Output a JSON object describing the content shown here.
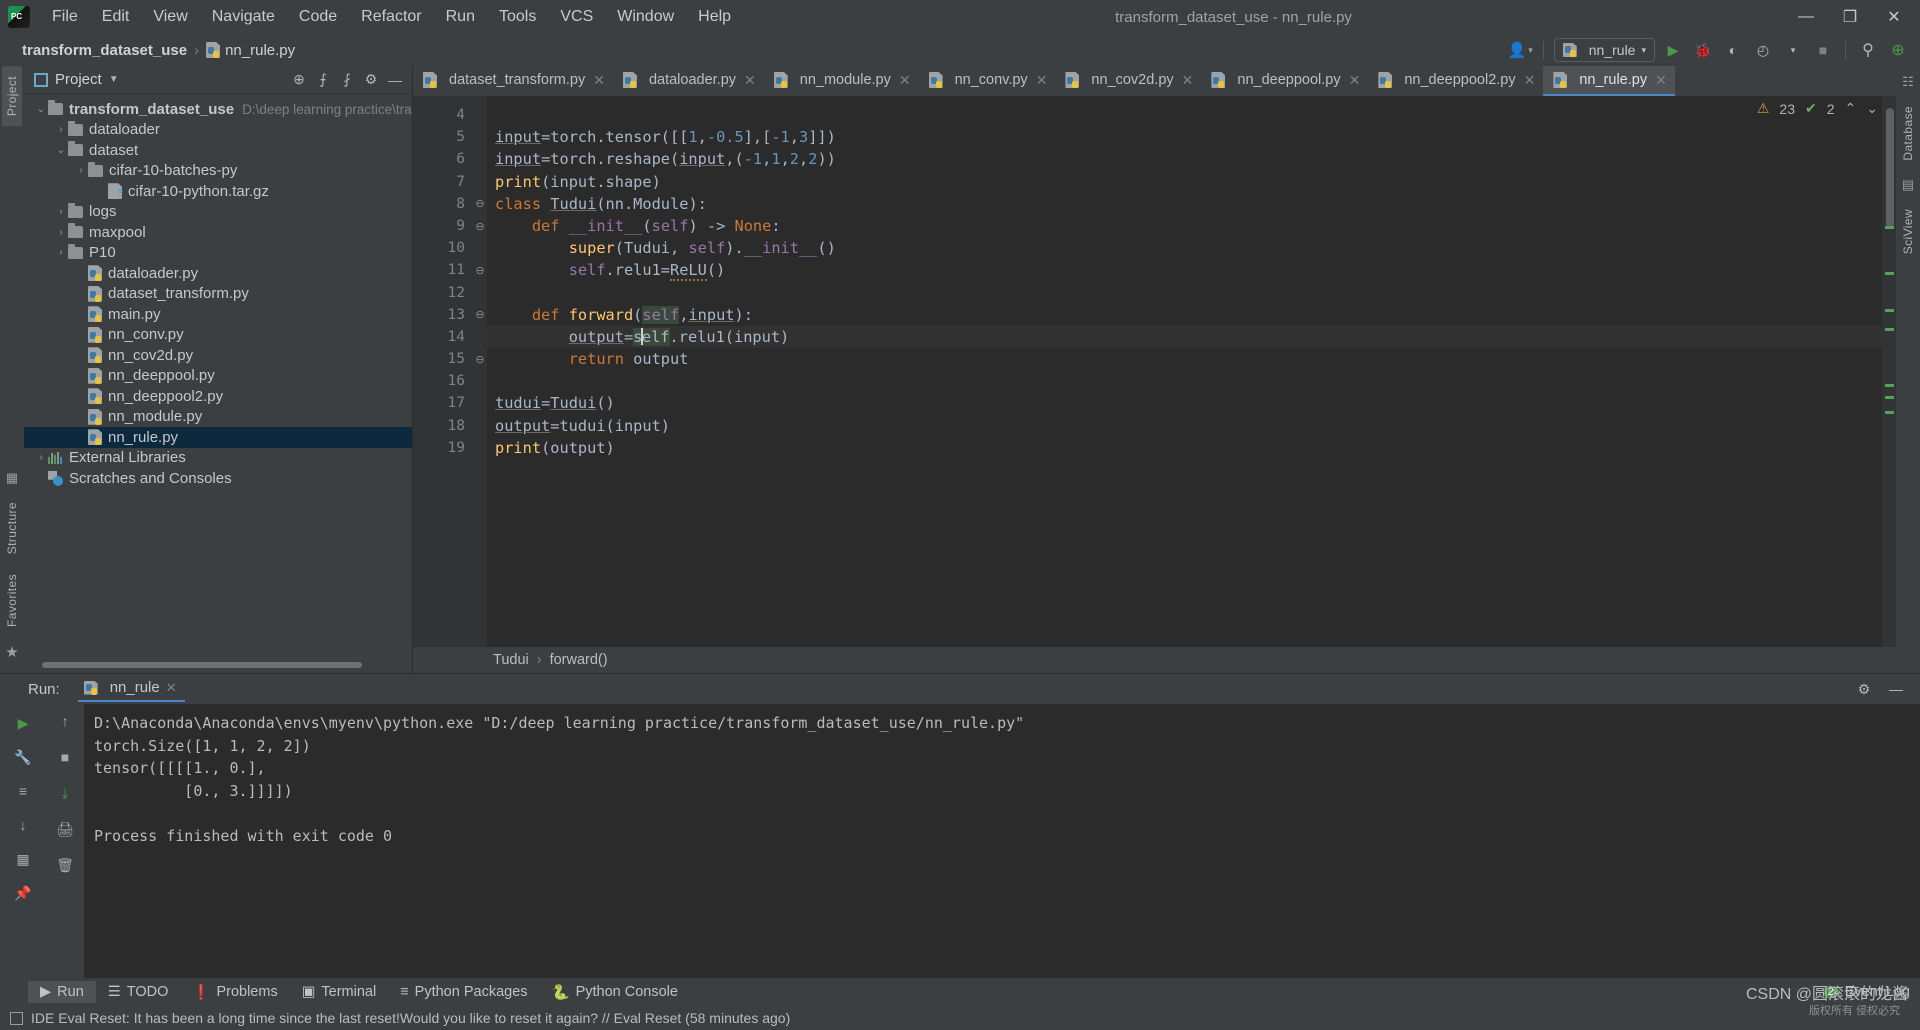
{
  "window": {
    "title": "transform_dataset_use - nn_rule.py",
    "minimize": "—",
    "maximize": "❐",
    "close": "✕"
  },
  "menu": [
    "File",
    "Edit",
    "View",
    "Navigate",
    "Code",
    "Refactor",
    "Run",
    "Tools",
    "VCS",
    "Window",
    "Help"
  ],
  "breadcrumb": {
    "project": "transform_dataset_use",
    "separator": "›",
    "file": "nn_rule.py"
  },
  "toolbar": {
    "run_config": "nn_rule",
    "run": "▶",
    "debug": "🐞",
    "coverage": "◐",
    "profile": "◴",
    "stop": "■",
    "search": "⚲",
    "updates": "⊕",
    "account": "👤"
  },
  "project_panel": {
    "title": "Project",
    "tools": [
      "⊕",
      "⨍",
      "⨏",
      "⚙",
      "—"
    ],
    "tree": [
      {
        "label": "transform_dataset_use",
        "path": "D:\\deep learning practice\\transfor",
        "indent": 0,
        "icon": "folder",
        "arrow": "v",
        "bold": true
      },
      {
        "label": "dataloader",
        "path": "",
        "indent": 1,
        "icon": "folder",
        "arrow": ">",
        "bold": false
      },
      {
        "label": "dataset",
        "path": "",
        "indent": 1,
        "icon": "folder",
        "arrow": "v",
        "bold": false
      },
      {
        "label": "cifar-10-batches-py",
        "path": "",
        "indent": 2,
        "icon": "folder",
        "arrow": ">",
        "bold": false
      },
      {
        "label": "cifar-10-python.tar.gz",
        "path": "",
        "indent": 3,
        "icon": "archive",
        "arrow": "",
        "bold": false
      },
      {
        "label": "logs",
        "path": "",
        "indent": 1,
        "icon": "folder",
        "arrow": ">",
        "bold": false
      },
      {
        "label": "maxpool",
        "path": "",
        "indent": 1,
        "icon": "folder",
        "arrow": ">",
        "bold": false
      },
      {
        "label": "P10",
        "path": "",
        "indent": 1,
        "icon": "folder",
        "arrow": ">",
        "bold": false
      },
      {
        "label": "dataloader.py",
        "path": "",
        "indent": 2,
        "icon": "python",
        "arrow": "",
        "bold": false
      },
      {
        "label": "dataset_transform.py",
        "path": "",
        "indent": 2,
        "icon": "python",
        "arrow": "",
        "bold": false
      },
      {
        "label": "main.py",
        "path": "",
        "indent": 2,
        "icon": "python",
        "arrow": "",
        "bold": false
      },
      {
        "label": "nn_conv.py",
        "path": "",
        "indent": 2,
        "icon": "python",
        "arrow": "",
        "bold": false
      },
      {
        "label": "nn_cov2d.py",
        "path": "",
        "indent": 2,
        "icon": "python",
        "arrow": "",
        "bold": false
      },
      {
        "label": "nn_deeppool.py",
        "path": "",
        "indent": 2,
        "icon": "python",
        "arrow": "",
        "bold": false
      },
      {
        "label": "nn_deeppool2.py",
        "path": "",
        "indent": 2,
        "icon": "python",
        "arrow": "",
        "bold": false
      },
      {
        "label": "nn_module.py",
        "path": "",
        "indent": 2,
        "icon": "python",
        "arrow": "",
        "bold": false
      },
      {
        "label": "nn_rule.py",
        "path": "",
        "indent": 2,
        "icon": "python",
        "arrow": "",
        "bold": false,
        "selected": true
      },
      {
        "label": "External Libraries",
        "path": "",
        "indent": 0,
        "icon": "libs",
        "arrow": ">",
        "bold": false
      },
      {
        "label": "Scratches and Consoles",
        "path": "",
        "indent": 0,
        "icon": "scratch",
        "arrow": "",
        "bold": false
      }
    ]
  },
  "left_strip": {
    "project_tab": "Project",
    "structure_tab": "Structure",
    "favorites_tab": "Favorites"
  },
  "right_strip": {
    "database_tab": "Database",
    "sciview_tab": "SciView"
  },
  "editor_tabs": [
    {
      "label": "dataset_transform.py",
      "active": false
    },
    {
      "label": "dataloader.py",
      "active": false
    },
    {
      "label": "nn_module.py",
      "active": false
    },
    {
      "label": "nn_conv.py",
      "active": false
    },
    {
      "label": "nn_cov2d.py",
      "active": false
    },
    {
      "label": "nn_deeppool.py",
      "active": false
    },
    {
      "label": "nn_deeppool2.py",
      "active": false
    },
    {
      "label": "nn_rule.py",
      "active": true
    }
  ],
  "editor": {
    "inspections": {
      "warnings": "23",
      "weak_warnings": "2",
      "warn_icon": "⚠",
      "ok_icon": "✔",
      "up": "⌃",
      "down": "⌄"
    },
    "first_line_number": 4,
    "current_line": 14,
    "lines": [
      {
        "n": 4,
        "text": ""
      },
      {
        "n": 5,
        "text": "input=torch.tensor([[1,-0.5],[-1,3]])"
      },
      {
        "n": 6,
        "text": "input=torch.reshape(input,(-1,1,2,2))"
      },
      {
        "n": 7,
        "text": "print(input.shape)"
      },
      {
        "n": 8,
        "text": "class Tudui(nn.Module):"
      },
      {
        "n": 9,
        "text": "    def __init__(self) -> None:"
      },
      {
        "n": 10,
        "text": "        super(Tudui, self).__init__()"
      },
      {
        "n": 11,
        "text": "        self.relu1=ReLU()"
      },
      {
        "n": 12,
        "text": ""
      },
      {
        "n": 13,
        "text": "    def forward(self,input):"
      },
      {
        "n": 14,
        "text": "        output=self.relu1(input)"
      },
      {
        "n": 15,
        "text": "        return output"
      },
      {
        "n": 16,
        "text": ""
      },
      {
        "n": 17,
        "text": "tudui=Tudui()"
      },
      {
        "n": 18,
        "text": "output=tudui(input)"
      },
      {
        "n": 19,
        "text": "print(output)"
      }
    ],
    "breadcrumb": {
      "class": "Tudui",
      "sep": "›",
      "method": "forward()"
    }
  },
  "run_panel": {
    "label": "Run:",
    "tab": "nn_rule",
    "close": "✕",
    "settings_icon": "⚙",
    "hide_icon": "—",
    "tools": [
      "▶",
      "↑",
      "■",
      "⤓",
      "🖨",
      "🗑"
    ],
    "console": [
      "D:\\Anaconda\\Anaconda\\envs\\myenv\\python.exe \"D:/deep learning practice/transform_dataset_use/nn_rule.py\"",
      "torch.Size([1, 1, 2, 2])",
      "tensor([[[[1., 0.],",
      "          [0., 3.]]]])",
      "",
      "Process finished with exit code 0"
    ]
  },
  "bottom_bar": {
    "tabs": [
      {
        "label": "Run",
        "icon": "▶",
        "selected": true
      },
      {
        "label": "TODO",
        "icon": "☰",
        "selected": false
      },
      {
        "label": "Problems",
        "icon": "❗",
        "selected": false
      },
      {
        "label": "Terminal",
        "icon": "▣",
        "selected": false
      },
      {
        "label": "Python Packages",
        "icon": "≡",
        "selected": false
      },
      {
        "label": "Python Console",
        "icon": "🐍",
        "selected": false
      }
    ],
    "event_log": "Event Log",
    "event_count": "2"
  },
  "status_bar": {
    "message": "IDE Eval Reset: It has been a long time since the last reset!Would you like to reset it again? // Eval Reset (58 minutes ago)"
  },
  "watermark": {
    "text": "CSDN @圆滚滚的龙酱",
    "sub": "版权所有 侵权必究"
  },
  "colors": {
    "accent": "#4a88c7",
    "selection": "#0d293e",
    "editor_bg": "#2b2b2b",
    "panel_bg": "#3c3f41"
  }
}
